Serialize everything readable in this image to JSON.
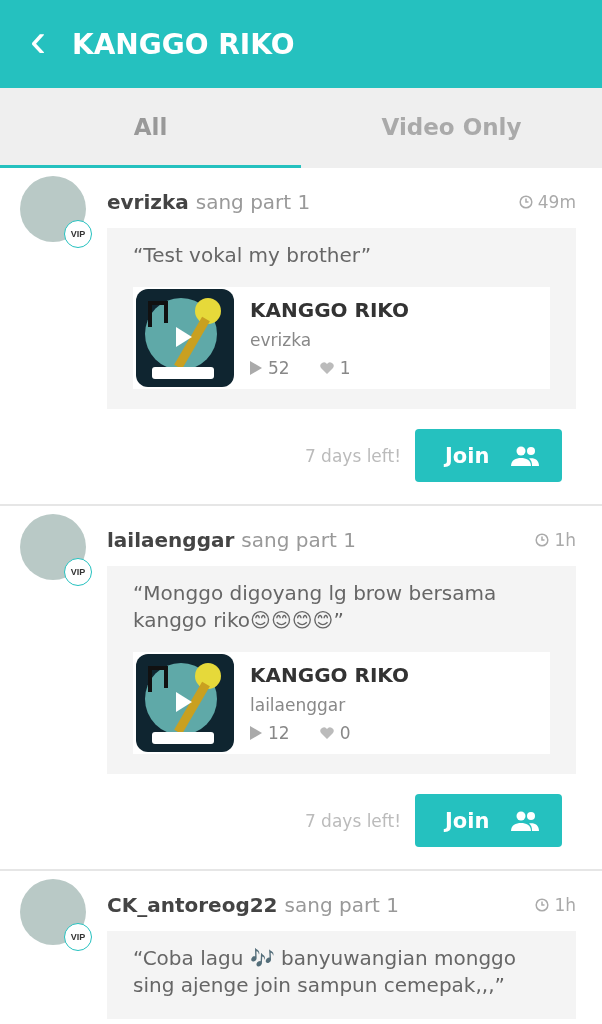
{
  "header": {
    "back_icon": "‹",
    "title": "KANGGO RIKO"
  },
  "tabs": [
    {
      "label": "All",
      "selected": true
    },
    {
      "label": "Video Only",
      "selected": false
    }
  ],
  "posts": [
    {
      "user": "evrizka",
      "action": "sang part 1",
      "time": "49m",
      "vip": true,
      "vip_label": "VIP",
      "message": "“Test vokal my brother”",
      "song": {
        "title": "KANGGO RIKO",
        "artist": "evrizka",
        "plays": "52",
        "likes": "1"
      },
      "deadline": "7 days left!",
      "button": "Join"
    },
    {
      "user": "lailaenggar",
      "action": "sang part 1",
      "time": "1h",
      "vip": true,
      "vip_label": "VIP",
      "message": "“Monggo digoyang lg brow bersama kanggo riko😊😊😊😊”",
      "song": {
        "title": "KANGGO RIKO",
        "artist": "lailaenggar",
        "plays": "12",
        "likes": "0"
      },
      "deadline": "7 days left!",
      "button": "Join"
    },
    {
      "user": "CK_antoreog22",
      "action": "sang part 1",
      "time": "1h",
      "vip": true,
      "vip_label": "VIP",
      "message": "“Coba lagu 🎶 banyuwangian monggo sing ajenge join sampun cemepak,,,”"
    }
  ]
}
